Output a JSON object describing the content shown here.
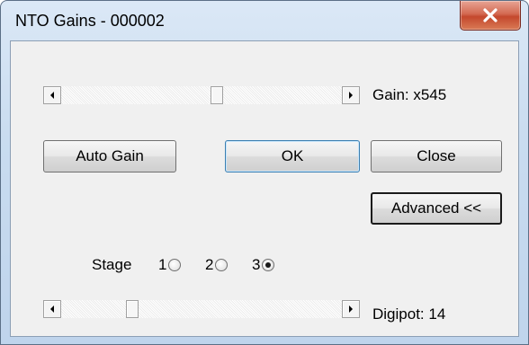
{
  "window": {
    "title": "NTO Gains - 000002"
  },
  "gain": {
    "label": "Gain: x545"
  },
  "buttons": {
    "auto_gain": "Auto Gain",
    "ok": "OK",
    "close": "Close",
    "advanced": "Advanced <<"
  },
  "stage": {
    "label": "Stage",
    "options": [
      {
        "label": "1",
        "selected": false
      },
      {
        "label": "2",
        "selected": false
      },
      {
        "label": "3",
        "selected": true
      }
    ]
  },
  "digipot": {
    "label": "Digipot: 14"
  },
  "icons": {
    "close": "close-icon",
    "scroll_left": "arrow-left-icon",
    "scroll_right": "arrow-right-icon"
  },
  "colors": {
    "close_button": "#c4482d",
    "window_frame": "#bfd4ec",
    "client_background": "#f0f0f0"
  }
}
